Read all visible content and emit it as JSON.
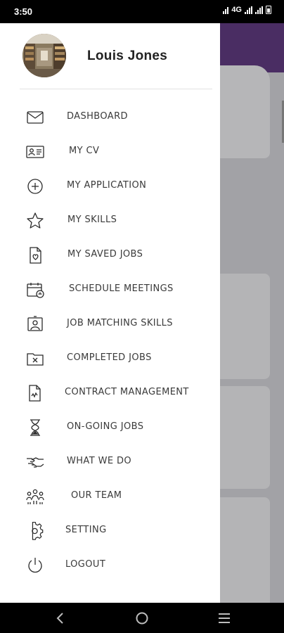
{
  "status_bar": {
    "time": "3:50",
    "network": "4G"
  },
  "user": {
    "name": "Louis Jones"
  },
  "menu": {
    "items": [
      {
        "label": "DASHBOARD",
        "icon": "mail-icon"
      },
      {
        "label": "MY CV",
        "icon": "id-card-icon"
      },
      {
        "label": "MY APPLICATION",
        "icon": "plus-circle-icon"
      },
      {
        "label": "MY SKILLS",
        "icon": "star-icon"
      },
      {
        "label": "MY SAVED JOBS",
        "icon": "saved-document-icon"
      },
      {
        "label": "SCHEDULE MEETINGS",
        "icon": "calendar-icon"
      },
      {
        "label": "JOB MATCHING SKILLS",
        "icon": "profile-frame-icon"
      },
      {
        "label": "COMPLETED JOBS",
        "icon": "folder-x-icon"
      },
      {
        "label": "CONTRACT MANAGEMENT",
        "icon": "contract-document-icon"
      },
      {
        "label": "ON-GOING JOBS",
        "icon": "hourglass-icon"
      },
      {
        "label": "WHAT WE DO",
        "icon": "handshake-icon"
      },
      {
        "label": "OUR TEAM",
        "icon": "team-icon"
      },
      {
        "label": "SETTING",
        "icon": "gear-icon"
      },
      {
        "label": "LOGOUT",
        "icon": "power-icon"
      }
    ]
  },
  "colors": {
    "header_purple": "#4a2d63",
    "scrim": "#a2a2a6",
    "drawer_bg": "#ffffff",
    "label_text": "#3a3a3a"
  }
}
